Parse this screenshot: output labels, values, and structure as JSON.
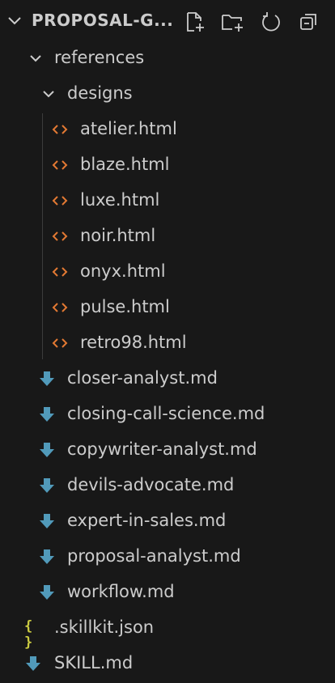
{
  "explorer": {
    "title": "PROPOSAL-G...",
    "actions": [
      {
        "name": "new-file-icon"
      },
      {
        "name": "new-folder-icon"
      },
      {
        "name": "refresh-icon"
      },
      {
        "name": "collapse-all-icon"
      }
    ]
  },
  "tree": {
    "references": "references",
    "designs": "designs",
    "design_files": [
      "atelier.html",
      "blaze.html",
      "luxe.html",
      "noir.html",
      "onyx.html",
      "pulse.html",
      "retro98.html"
    ],
    "reference_files": [
      "closer-analyst.md",
      "closing-call-science.md",
      "copywriter-analyst.md",
      "devils-advocate.md",
      "expert-in-sales.md",
      "proposal-analyst.md",
      "workflow.md"
    ],
    "root_files": [
      ".skillkit.json",
      "SKILL.md"
    ]
  },
  "icons": {
    "html": "code-angle-icon",
    "markdown": "markdown-download-icon",
    "json": "json-braces-icon",
    "json_glyph": "{ }"
  },
  "colors": {
    "background": "#181818",
    "text": "#cccccc",
    "html_icon": "#e37933",
    "markdown_icon": "#519aba",
    "json_icon": "#cbcb41",
    "guide": "#3c3c3c"
  }
}
